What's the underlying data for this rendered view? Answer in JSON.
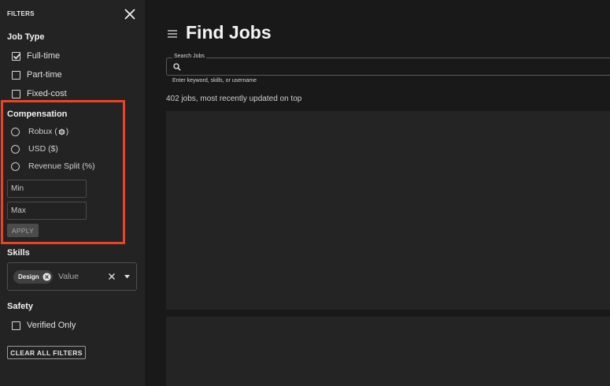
{
  "sidebar": {
    "header": "FILTERS",
    "job_type": {
      "title": "Job Type",
      "options": [
        {
          "label": "Full-time",
          "checked": true
        },
        {
          "label": "Part-time",
          "checked": false
        },
        {
          "label": "Fixed-cost",
          "checked": false
        }
      ]
    },
    "compensation": {
      "title": "Compensation",
      "options": [
        {
          "label_prefix": "Robux (",
          "label_suffix": ")",
          "icon": "robux-icon"
        },
        {
          "label": "USD ($)"
        },
        {
          "label": "Revenue Split (%)"
        }
      ],
      "min_placeholder": "Min",
      "max_placeholder": "Max",
      "apply_label": "APPLY",
      "highlight_color": "#ee4226"
    },
    "skills": {
      "title": "Skills",
      "chips": [
        {
          "label": "Design"
        }
      ],
      "value_placeholder": "Value"
    },
    "safety": {
      "title": "Safety",
      "options": [
        {
          "label": "Verified Only",
          "checked": false
        }
      ]
    },
    "clear_all_label": "CLEAR ALL FILTERS"
  },
  "main": {
    "title": "Find Jobs",
    "search": {
      "label": "Search Jobs",
      "value": "",
      "helper": "Enter keyword, skills, or username"
    },
    "results_text": "402 jobs, most recently updated on top"
  }
}
